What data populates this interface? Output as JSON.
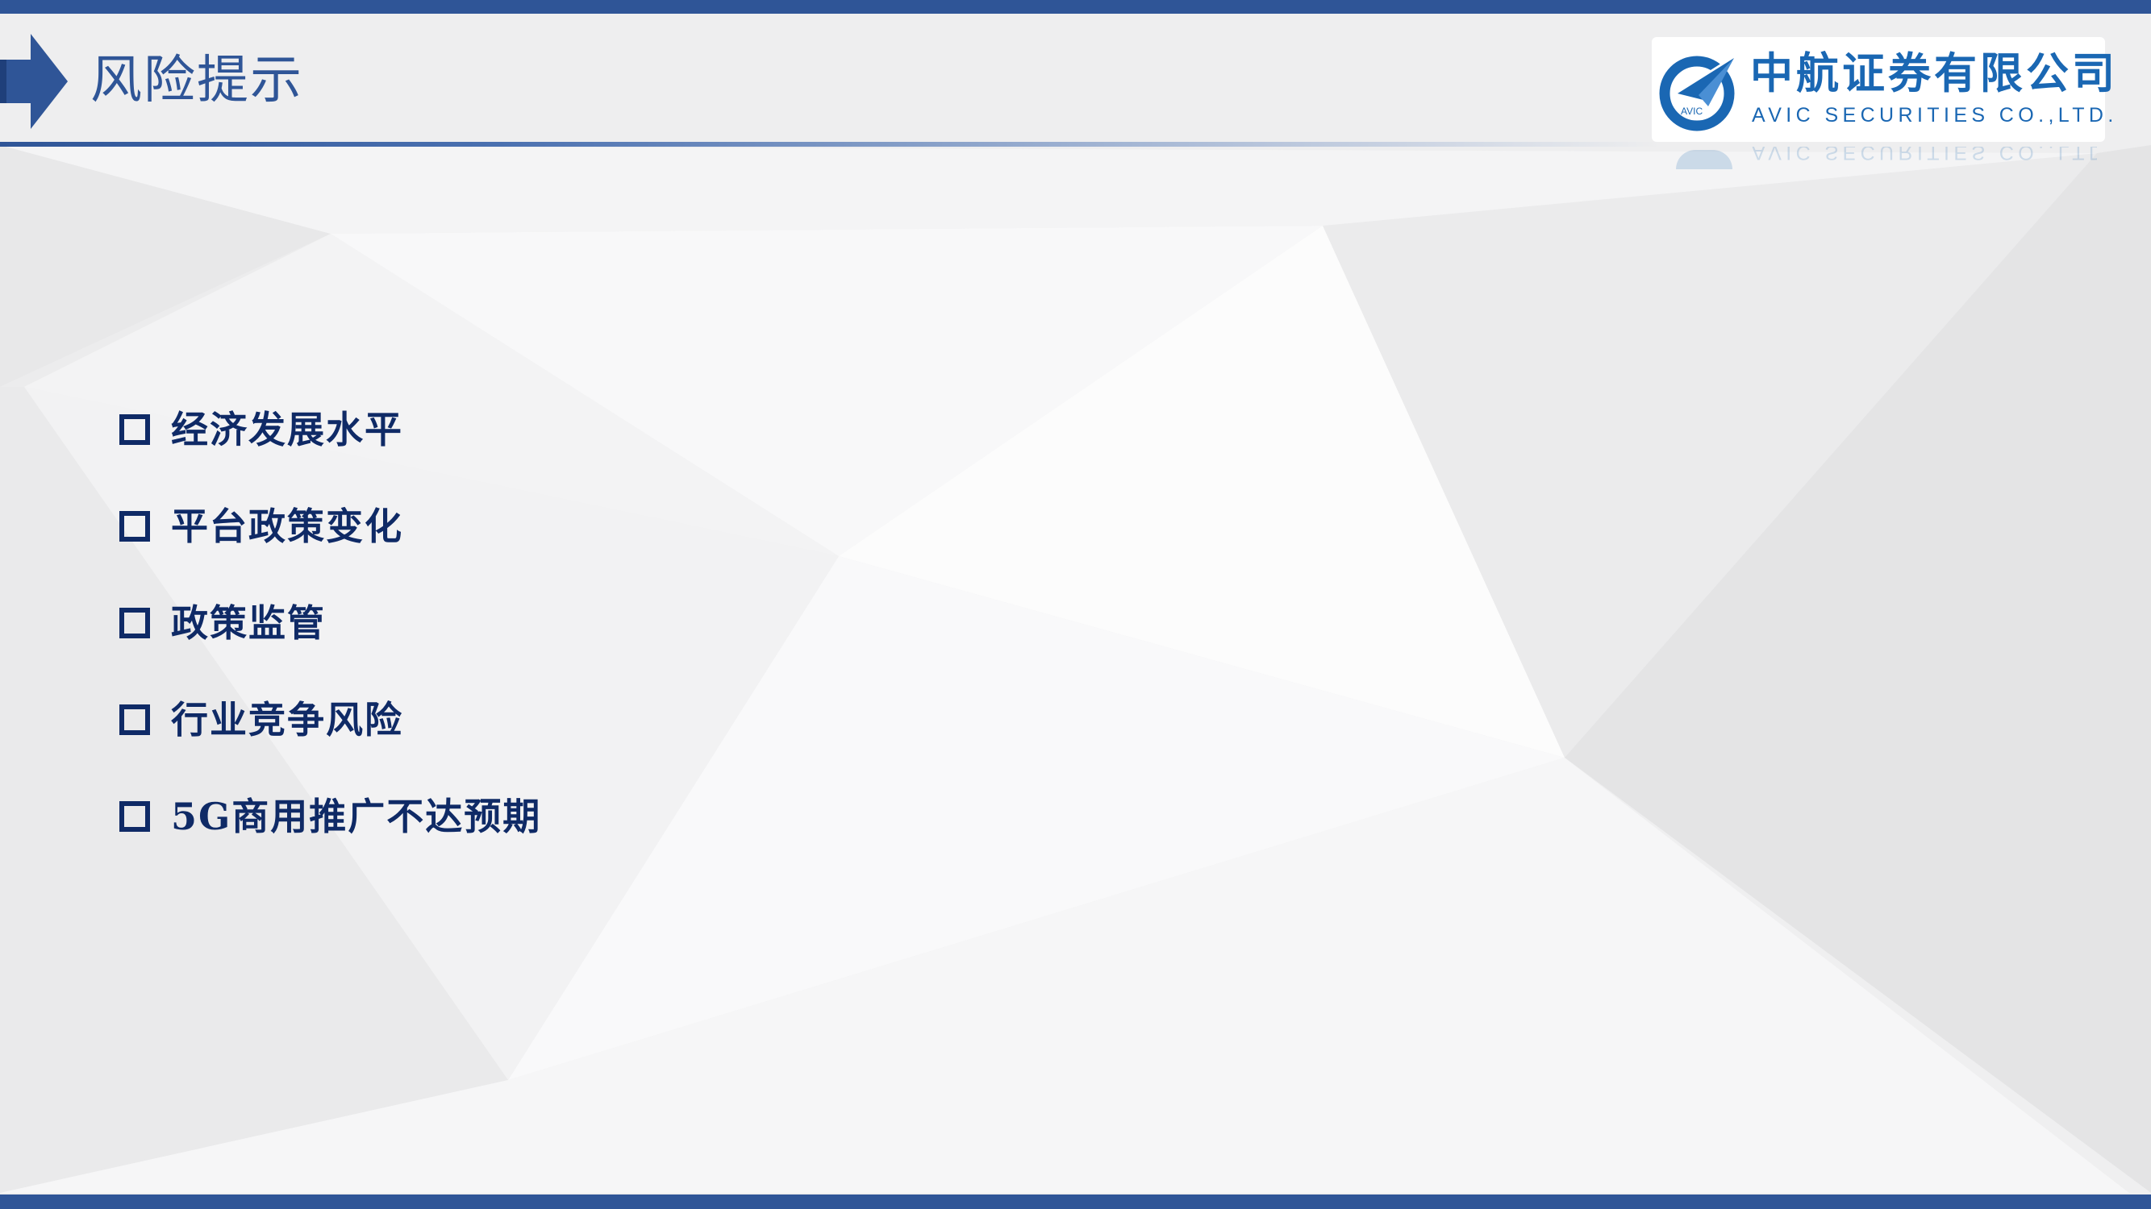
{
  "slide": {
    "title": "风险提示",
    "accent_color": "#2f5597",
    "text_color": "#0f2a66"
  },
  "logo": {
    "name_cn": "中航证券有限公司",
    "name_en": "AVIC SECURITIES CO.,LTD.",
    "emblem_text": "AVIC",
    "color": "#1a67b3"
  },
  "risks": [
    {
      "label": "经济发展水平",
      "icon": "checkbox-icon"
    },
    {
      "label": "平台政策变化",
      "icon": "checkbox-icon"
    },
    {
      "label": "政策监管",
      "icon": "checkbox-icon"
    },
    {
      "label": "行业竞争风险",
      "icon": "checkbox-icon"
    },
    {
      "label": "5G商用推广不达预期",
      "icon": "checkbox-icon"
    }
  ]
}
